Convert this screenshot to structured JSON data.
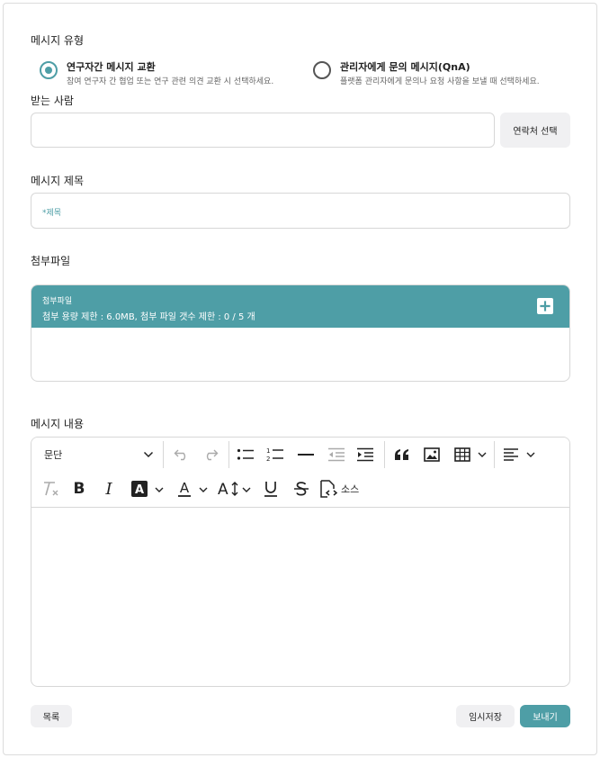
{
  "message_type": {
    "label": "메시지 유형",
    "options": [
      {
        "title": "연구자간 메시지 교환",
        "desc": "참여 연구자 간 협업 또는 연구 관련 의견 교환 시 선택하세요.",
        "checked": true
      },
      {
        "title": "관리자에게 문의 메시지(QnA)",
        "desc": "플랫폼 관리자에게 문의나 요청 사항을 보낼 때 선택하세요.",
        "checked": false
      }
    ]
  },
  "recipient": {
    "label": "받는 사람",
    "value": "",
    "contact_button": "연락처 선택"
  },
  "subject": {
    "label": "메시지 제목",
    "placeholder": "*제목"
  },
  "attachment": {
    "label": "첨부파일",
    "panel_title": "첨부파일",
    "limit_text": "첨부 용량 제한 : 6.0MB, 첨부 파일 갯수 제한 : 0 / 5 개",
    "add_icon": "plus-icon"
  },
  "content": {
    "label": "메시지 내용",
    "paragraph_select": "문단",
    "source_label": "소스",
    "toolbar_icons": [
      "undo-icon",
      "redo-icon",
      "bulleted-list-icon",
      "numbered-list-icon",
      "horizontal-line-icon",
      "outdent-icon",
      "indent-icon",
      "blockquote-icon",
      "image-icon",
      "table-icon",
      "align-icon",
      "remove-format-icon",
      "bold-icon",
      "italic-icon",
      "highlight-icon",
      "font-color-icon",
      "font-size-icon",
      "underline-icon",
      "strikethrough-icon",
      "source-icon"
    ]
  },
  "footer": {
    "list_button": "목록",
    "draft_button": "임시저장",
    "send_button": "보내기"
  },
  "colors": {
    "accent": "#4e9ea6",
    "button_gray": "#f0f0f2",
    "border": "#d7d7d7"
  }
}
